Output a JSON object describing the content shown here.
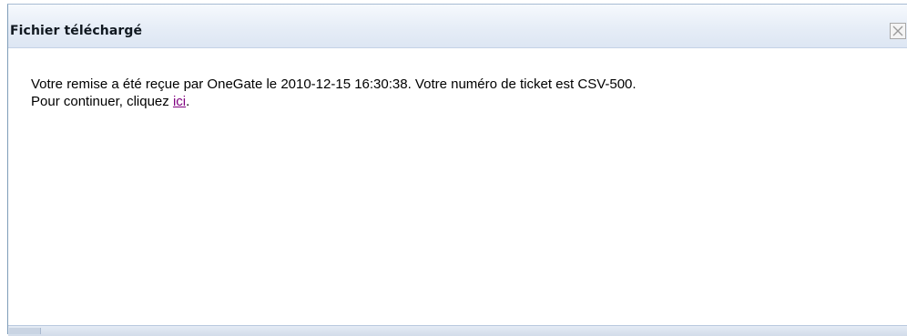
{
  "dialog": {
    "title": "Fichier téléchargé",
    "close_icon": "close-icon",
    "message": {
      "line1": "Votre remise a été reçue par OneGate le 2010-12-15 16:30:38. Votre numéro de ticket est CSV-500.",
      "continue_prefix": "Pour continuer, cliquez ",
      "link_text": "ici",
      "continue_suffix": "."
    }
  },
  "colors": {
    "titlebar": "#e6edf7",
    "link_visited": "#800080",
    "border": "#7f9db9"
  }
}
